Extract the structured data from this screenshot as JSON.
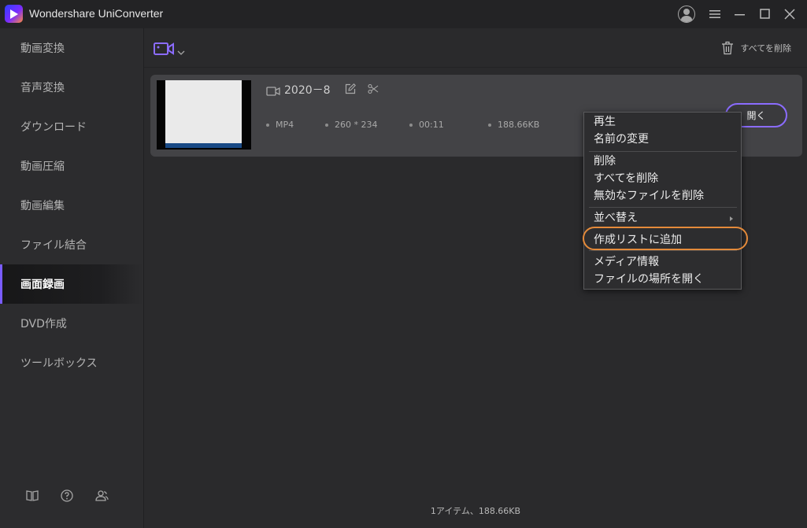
{
  "window": {
    "title": "Wondershare UniConverter",
    "icons": [
      "account-icon",
      "menu-icon",
      "minimize-icon",
      "maximize-icon",
      "close-icon"
    ]
  },
  "sidebar": {
    "items": [
      {
        "label": "動画変換",
        "active": false
      },
      {
        "label": "音声変換",
        "active": false
      },
      {
        "label": "ダウンロード",
        "active": false
      },
      {
        "label": "動画圧縮",
        "active": false
      },
      {
        "label": "動画編集",
        "active": false
      },
      {
        "label": "ファイル結合",
        "active": false
      },
      {
        "label": "画面録画",
        "active": true
      },
      {
        "label": "DVD作成",
        "active": false
      },
      {
        "label": "ツールボックス",
        "active": false
      }
    ],
    "footer_icons": [
      "book-icon",
      "help-icon",
      "users-icon"
    ]
  },
  "toolbar": {
    "delete_all_label": "すべてを削除"
  },
  "file": {
    "name": "2020－8",
    "format": "MP4",
    "resolution": "260 * 234",
    "duration": "00:11",
    "size": "188.66KB",
    "open_label": "開く"
  },
  "context_menu": {
    "items": [
      "再生",
      "名前の変更",
      "削除",
      "すべてを削除",
      "無効なファイルを削除",
      "並べ替え",
      "作成リストに追加",
      "メディア情報",
      "ファイルの場所を開く"
    ]
  },
  "status_bar": {
    "text": "1アイテム、188.66KB"
  },
  "colors": {
    "accent": "#7a5cff",
    "highlight_ring": "#e48a3a",
    "background": "#2a2a2c"
  }
}
